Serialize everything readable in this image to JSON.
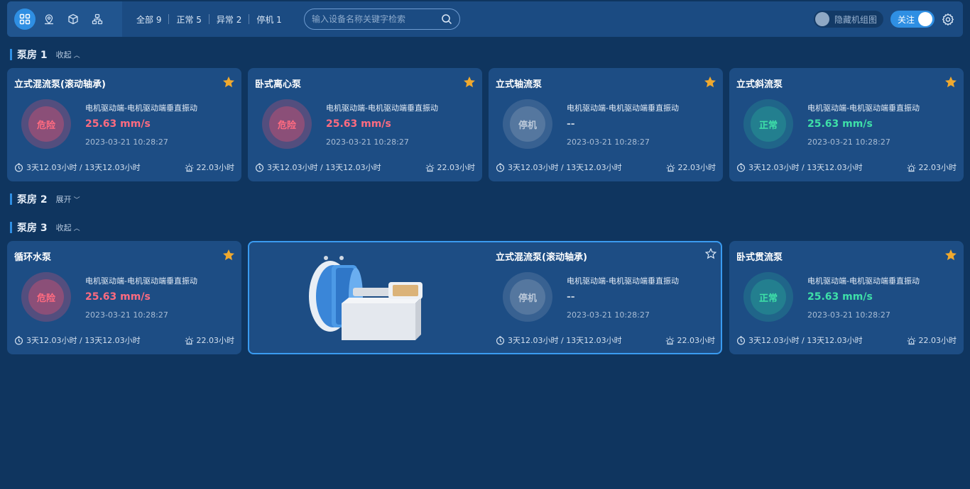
{
  "toolbar": {
    "view_buttons": [
      "grid-view-icon",
      "map-view-icon",
      "model-view-icon",
      "tree-view-icon"
    ],
    "filters": [
      {
        "label": "全部 9"
      },
      {
        "label": "正常 5"
      },
      {
        "label": "异常 2"
      },
      {
        "label": "停机 1"
      }
    ],
    "search": {
      "placeholder": "输入设备名称关键字检索",
      "value": ""
    },
    "hide_group_label": "隐藏机组图",
    "hide_group_on": false,
    "follow_label": "关注",
    "follow_on": true
  },
  "colors": {
    "accent": "#2f8fe3",
    "danger": "#ff6b80",
    "normal": "#3ee0a8",
    "stop": "#b9c7d8",
    "star": "#f0a92e"
  },
  "sections": [
    {
      "title": "泵房 1",
      "toggle": "收起",
      "expanded": true,
      "cards": [
        {
          "title": "立式混流泵(滚动轴承)",
          "status": "危险",
          "status_type": "danger",
          "metric": "电机驱动端-电机驱动端垂直振动",
          "value": "25.63 mm/s",
          "time": "2023-03-21 10:28:27",
          "runtime": "3天12.03小时 / 13天12.03小时",
          "alarm": "22.03小时",
          "starred": true
        },
        {
          "title": "卧式离心泵",
          "status": "危险",
          "status_type": "danger",
          "metric": "电机驱动端-电机驱动端垂直振动",
          "value": "25.63 mm/s",
          "time": "2023-03-21 10:28:27",
          "runtime": "3天12.03小时 / 13天12.03小时",
          "alarm": "22.03小时",
          "starred": true
        },
        {
          "title": "立式轴流泵",
          "status": "停机",
          "status_type": "stop",
          "metric": "电机驱动端-电机驱动端垂直振动",
          "value": "--",
          "time": "2023-03-21 10:28:27",
          "runtime": "3天12.03小时 / 13天12.03小时",
          "alarm": "22.03小时",
          "starred": true
        },
        {
          "title": "立式斜流泵",
          "status": "正常",
          "status_type": "normal",
          "metric": "电机驱动端-电机驱动端垂直振动",
          "value": "25.63 mm/s",
          "time": "2023-03-21 10:28:27",
          "runtime": "3天12.03小时 / 13天12.03小时",
          "alarm": "22.03小时",
          "starred": true
        }
      ]
    },
    {
      "title": "泵房 2",
      "toggle": "展开",
      "expanded": false,
      "cards": []
    },
    {
      "title": "泵房 3",
      "toggle": "收起",
      "expanded": true,
      "cards": [
        {
          "title": "循环水泵",
          "status": "危险",
          "status_type": "danger",
          "metric": "电机驱动端-电机驱动端垂直振动",
          "value": "25.63 mm/s",
          "time": "2023-03-21 10:28:27",
          "runtime": "3天12.03小时 / 13天12.03小时",
          "alarm": "22.03小时",
          "starred": true
        },
        {
          "title": "立式混流泵(滚动轴承)",
          "status": "停机",
          "status_type": "stop",
          "metric": "电机驱动端-电机驱动端垂直振动",
          "value": "--",
          "time": "2023-03-21 10:28:27",
          "runtime": "3天12.03小时 / 13天12.03小时",
          "alarm": "22.03小时",
          "starred": false,
          "has_image": true
        },
        {
          "title": "卧式贯流泵",
          "status": "正常",
          "status_type": "normal",
          "metric": "电机驱动端-电机驱动端垂直振动",
          "value": "25.63 mm/s",
          "time": "2023-03-21 10:28:27",
          "runtime": "3天12.03小时 / 13天12.03小时",
          "alarm": "22.03小时",
          "starred": true
        }
      ]
    }
  ]
}
